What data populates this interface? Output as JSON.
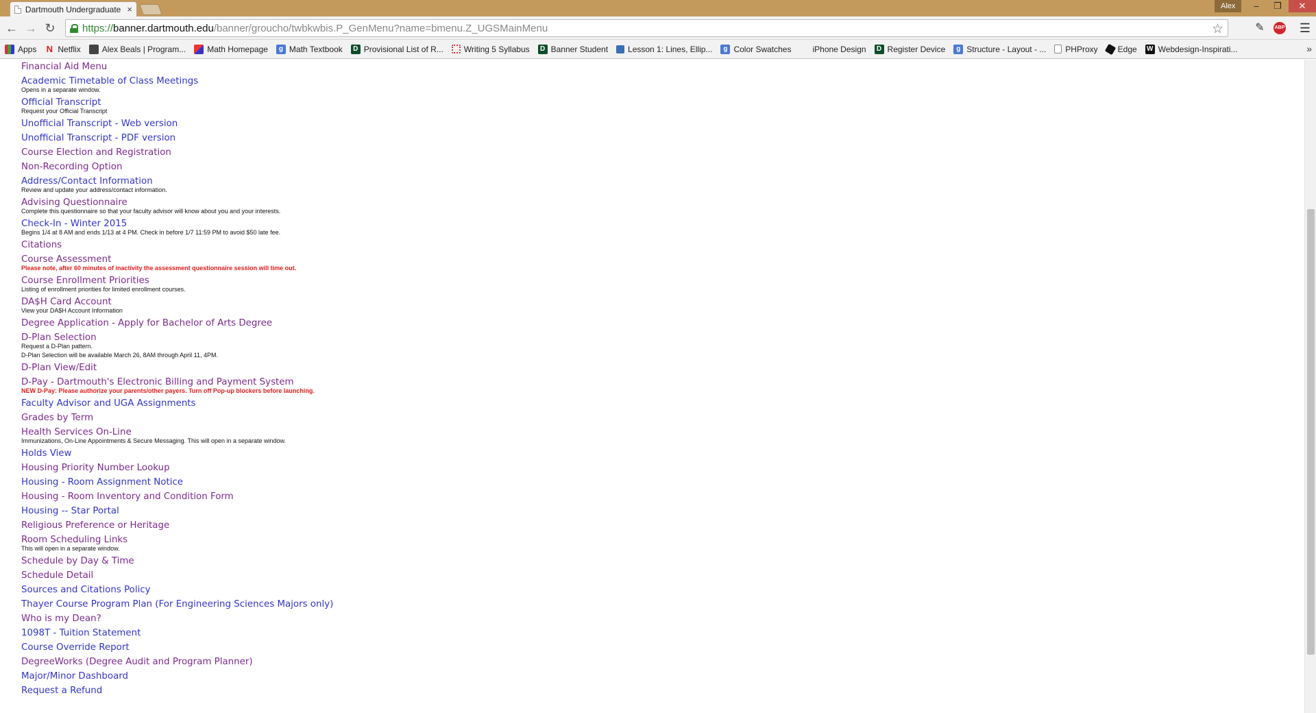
{
  "browser": {
    "tab_title": "Dartmouth Undergraduate",
    "tab_close": "×",
    "profile_name": "Alex",
    "window_min": "–",
    "window_max": "❐",
    "window_close": "✕",
    "url_scheme": "https://",
    "url_host": "banner.dartmouth.edu",
    "url_path": "/banner/groucho/twbkwbis.P_GenMenu?name=bmenu.Z_UGSMainMenu",
    "secure_color": "#2e8b2e",
    "icons": [
      "back-arrow-icon",
      "forward-arrow-icon",
      "reload-icon",
      "lock-icon",
      "star-icon",
      "pencil-icon",
      "adblock-icon",
      "hamburger-menu-icon"
    ]
  },
  "bookmarks": [
    {
      "label": "Apps",
      "icon": "apps-grid-icon",
      "glyph": ""
    },
    {
      "label": "Netflix",
      "icon": "netflix-icon",
      "glyph": "N"
    },
    {
      "label": "Alex Beals | Program...",
      "icon": "site-icon",
      "glyph": ""
    },
    {
      "label": "Math Homepage",
      "icon": "math-icon",
      "glyph": ""
    },
    {
      "label": "Math Textbook",
      "icon": "google-icon",
      "glyph": "g"
    },
    {
      "label": "Provisional List of R...",
      "icon": "dartmouth-icon",
      "glyph": "D"
    },
    {
      "label": "Writing 5 Syllabus",
      "icon": "ring-icon",
      "glyph": ""
    },
    {
      "label": "Banner Student",
      "icon": "dartmouth-icon",
      "glyph": "D"
    },
    {
      "label": "Lesson 1: Lines, Ellip...",
      "icon": "globe-icon",
      "glyph": ""
    },
    {
      "label": "Color Swatches",
      "icon": "google-icon",
      "glyph": "g"
    },
    {
      "label": "iPhone Design",
      "icon": "apple-icon",
      "glyph": ""
    },
    {
      "label": "Register Device",
      "icon": "dartmouth-icon",
      "glyph": "D"
    },
    {
      "label": "Structure - Layout - ...",
      "icon": "google-icon",
      "glyph": "g"
    },
    {
      "label": "PHProxy",
      "icon": "page-icon",
      "glyph": ""
    },
    {
      "label": "Edge",
      "icon": "hexagon-icon",
      "glyph": ""
    },
    {
      "label": "Webdesign-Inspirati...",
      "icon": "w-icon",
      "glyph": "W"
    }
  ],
  "bookmarks_more": "»",
  "menu_items": [
    {
      "label": "Financial Aid Menu",
      "visited": true,
      "desc": "",
      "desc2": "",
      "warn": false
    },
    {
      "label": "Academic Timetable of Class Meetings",
      "visited": false,
      "desc": "Opens in a separate window.",
      "desc2": "",
      "warn": false
    },
    {
      "label": "Official Transcript",
      "visited": false,
      "desc": "Request your Official Transcript",
      "desc2": "",
      "warn": false
    },
    {
      "label": "Unofficial Transcript - Web version",
      "visited": false,
      "desc": "",
      "desc2": "",
      "warn": false
    },
    {
      "label": "Unofficial Transcript - PDF version",
      "visited": false,
      "desc": "",
      "desc2": "",
      "warn": false
    },
    {
      "label": "Course Election and Registration",
      "visited": true,
      "desc": "",
      "desc2": "",
      "warn": false
    },
    {
      "label": "Non-Recording Option",
      "visited": true,
      "desc": "",
      "desc2": "",
      "warn": false
    },
    {
      "label": "Address/Contact Information",
      "visited": false,
      "desc": "Review and update your address/contact information.",
      "desc2": "",
      "warn": false
    },
    {
      "label": "Advising Questionnaire",
      "visited": true,
      "desc": "Complete this questionnaire so that your faculty advisor will know about you and your interests.",
      "desc2": "",
      "warn": false
    },
    {
      "label": "Check-In - Winter 2015",
      "visited": false,
      "desc": "Begins 1/4 at 8 AM and ends 1/13 at 4 PM. Check in before 1/7 11:59 PM to avoid $50 late fee.",
      "desc2": "",
      "warn": false
    },
    {
      "label": "Citations",
      "visited": true,
      "desc": "",
      "desc2": "",
      "warn": false
    },
    {
      "label": "Course Assessment",
      "visited": true,
      "desc": "Please note, after 60 minutes of inactivity the assessment questionnaire session will time out.",
      "desc2": "",
      "warn": true
    },
    {
      "label": "Course Enrollment Priorities",
      "visited": true,
      "desc": "Listing of enrollment priorities for limited enrollment courses.",
      "desc2": "",
      "warn": false
    },
    {
      "label": "DA$H Card Account",
      "visited": true,
      "desc": "View your DA$H Account Information",
      "desc2": "",
      "warn": false
    },
    {
      "label": "Degree Application - Apply for Bachelor of Arts Degree",
      "visited": true,
      "desc": "",
      "desc2": "",
      "warn": false
    },
    {
      "label": "D-Plan Selection",
      "visited": true,
      "desc": "Request a D-Plan pattern.",
      "desc2": "D-Plan Selection will be available March 26, 8AM through April 11, 4PM.",
      "warn": false
    },
    {
      "label": "D-Plan View/Edit",
      "visited": true,
      "desc": "",
      "desc2": "",
      "warn": false
    },
    {
      "label": "D-Pay - Dartmouth's Electronic Billing and Payment System",
      "visited": true,
      "desc": "NEW D-Pay: Please authorize your parents/other payers. Turn off Pop-up blockers before launching.",
      "desc2": "",
      "warn": true
    },
    {
      "label": "Faculty Advisor and UGA Assignments",
      "visited": false,
      "desc": "",
      "desc2": "",
      "warn": false
    },
    {
      "label": "Grades by Term",
      "visited": true,
      "desc": "",
      "desc2": "",
      "warn": false
    },
    {
      "label": "Health Services On-Line",
      "visited": true,
      "desc": "Immunizations, On-Line Appointments & Secure Messaging. This will open in a separate window.",
      "desc2": "",
      "warn": false
    },
    {
      "label": "Holds View",
      "visited": false,
      "desc": "",
      "desc2": "",
      "warn": false
    },
    {
      "label": "Housing Priority Number Lookup",
      "visited": true,
      "desc": "",
      "desc2": "",
      "warn": false
    },
    {
      "label": "Housing - Room Assignment Notice",
      "visited": false,
      "desc": "",
      "desc2": "",
      "warn": false
    },
    {
      "label": "Housing - Room Inventory and Condition Form",
      "visited": true,
      "desc": "",
      "desc2": "",
      "warn": false
    },
    {
      "label": "Housing -- Star Portal",
      "visited": false,
      "desc": "",
      "desc2": "",
      "warn": false
    },
    {
      "label": "Religious Preference or Heritage",
      "visited": true,
      "desc": "",
      "desc2": "",
      "warn": false
    },
    {
      "label": "Room Scheduling Links",
      "visited": true,
      "desc": "This will open in a separate window.",
      "desc2": "",
      "warn": false
    },
    {
      "label": "Schedule by Day & Time",
      "visited": true,
      "desc": "",
      "desc2": "",
      "warn": false
    },
    {
      "label": "Schedule Detail",
      "visited": true,
      "desc": "",
      "desc2": "",
      "warn": false
    },
    {
      "label": "Sources and Citations Policy",
      "visited": false,
      "desc": "",
      "desc2": "",
      "warn": false
    },
    {
      "label": "Thayer Course Program Plan (For Engineering Sciences Majors only)",
      "visited": false,
      "desc": "",
      "desc2": "",
      "warn": false
    },
    {
      "label": "Who is my Dean?",
      "visited": true,
      "desc": "",
      "desc2": "",
      "warn": false
    },
    {
      "label": "1098T - Tuition Statement",
      "visited": false,
      "desc": "",
      "desc2": "",
      "warn": false
    },
    {
      "label": "Course Override Report",
      "visited": false,
      "desc": "",
      "desc2": "",
      "warn": false
    },
    {
      "label": "DegreeWorks (Degree Audit and Program Planner)",
      "visited": true,
      "desc": "",
      "desc2": "",
      "warn": false
    },
    {
      "label": "Major/Minor Dashboard",
      "visited": false,
      "desc": "",
      "desc2": "",
      "warn": false
    },
    {
      "label": "Request a Refund",
      "visited": false,
      "desc": "",
      "desc2": "",
      "warn": false
    }
  ],
  "colors": {
    "link": "#3333cc",
    "visited_link": "#7a2a8c",
    "warning_text": "#e01b1b",
    "titlebar": "#c49a5c"
  }
}
